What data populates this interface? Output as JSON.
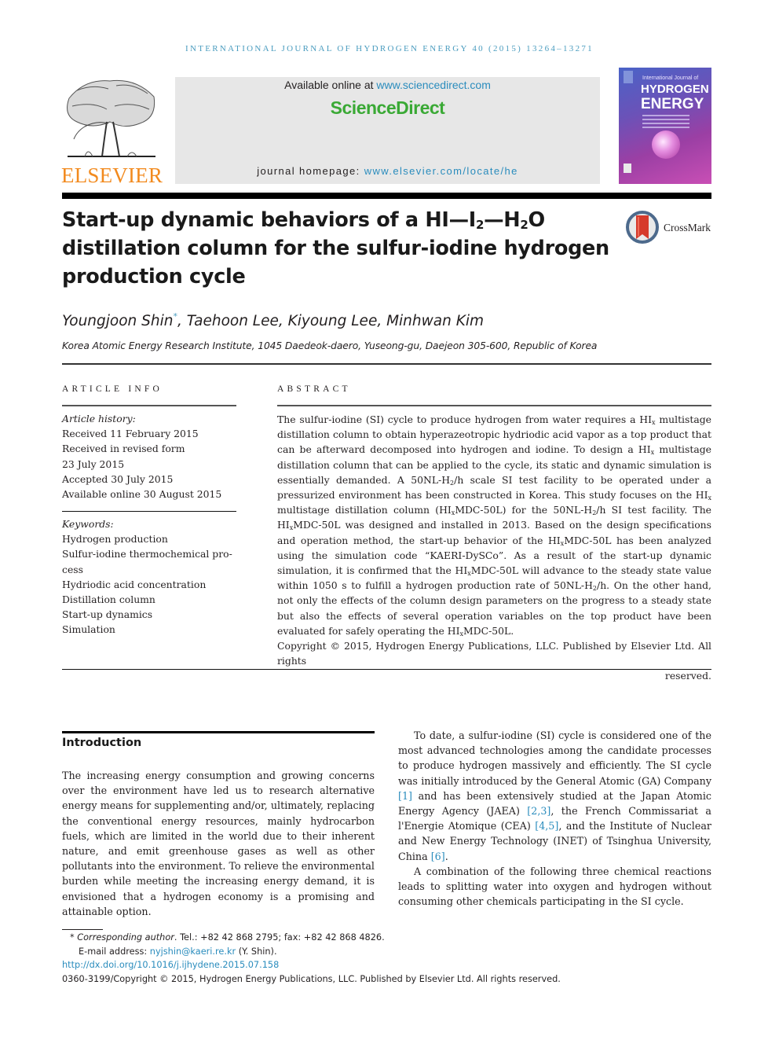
{
  "running_head": "International Journal of Hydrogen Energy 40 (2015) 13264–13271",
  "masthead": {
    "publisher_logo_text": "ELSEVIER",
    "available_online_prefix": "Available online at ",
    "available_online_link": "www.sciencedirect.com",
    "platform_name": "ScienceDirect",
    "homepage_prefix": "journal homepage: ",
    "homepage_link": "www.elsevier.com/locate/he",
    "cover": {
      "line1": "International Journal of",
      "line2": "HYDROGEN",
      "line3": "ENERGY"
    },
    "crossmark_label": "CrossMark"
  },
  "article": {
    "title_part1": "Start-up dynamic behaviors of a HI—I",
    "title_sub1": "2",
    "title_part2": "—H",
    "title_sub2": "2",
    "title_part3": "O distillation column for the sulfur-iodine hydrogen production cycle",
    "authors": {
      "first": "Youngjoon Shin",
      "corresponding_mark": "*",
      "rest": ", Taehoon Lee, Kiyoung Lee, Minhwan Kim"
    },
    "affiliation": "Korea Atomic Energy Research Institute, 1045 Daedeok-daero, Yuseong-gu, Daejeon 305-600, Republic of Korea"
  },
  "article_info": {
    "heading": "ARTICLE INFO",
    "history_label": "Article history:",
    "history": [
      "Received 11 February 2015",
      "Received in revised form",
      "23 July 2015",
      "Accepted 30 July 2015",
      "Available online 30 August 2015"
    ],
    "keywords_label": "Keywords:",
    "keywords": [
      "Hydrogen production",
      "Sulfur-iodine thermochemical pro-",
      "cess",
      "Hydriodic acid concentration",
      "Distillation column",
      "Start-up dynamics",
      "Simulation"
    ]
  },
  "abstract": {
    "heading": "ABSTRACT",
    "segments": [
      {
        "t": "The sulfur-iodine (SI) cycle to produce hydrogen from water requires a HI"
      },
      {
        "sub": "x"
      },
      {
        "t": " multistage distillation column to obtain hyperazeotropic hydriodic acid vapor as a top product that can be afterward decomposed into hydrogen and iodine. To design a HI"
      },
      {
        "sub": "x"
      },
      {
        "t": " multistage distillation column that can be applied to the cycle, its static and dynamic simulation is essentially demanded. A 50NL-H"
      },
      {
        "sub": "2"
      },
      {
        "t": "/h scale SI test facility to be operated under a pressurized environment has been constructed in Korea. This study focuses on the HI"
      },
      {
        "sub": "x"
      },
      {
        "t": " multistage distillation column (HI"
      },
      {
        "sub": "x"
      },
      {
        "t": "MDC-50L) for the 50NL-H"
      },
      {
        "sub": "2"
      },
      {
        "t": "/h SI test facility. The HI"
      },
      {
        "sub": "x"
      },
      {
        "t": "MDC-50L was designed and installed in 2013. Based on the design specifications and operation method, the start-up behavior of the HI"
      },
      {
        "sub": "x"
      },
      {
        "t": "MDC-50L has been analyzed using the simulation code “KAERI-DySCo”. As a result of the start-up dynamic simulation, it is confirmed that the HI"
      },
      {
        "sub": "x"
      },
      {
        "t": "MDC-50L will advance to the steady state value within 1050 s to fulfill a hydrogen production rate of 50NL-H"
      },
      {
        "sub": "2"
      },
      {
        "t": "/h. On the other hand, not only the effects of the column design parameters on the progress to a steady state but also the effects of several operation variables on the top product have been evaluated for safely operating the HI"
      },
      {
        "sub": "x"
      },
      {
        "t": "MDC-50L."
      }
    ],
    "copyright_line": "Copyright © 2015, Hydrogen Energy Publications, LLC. Published by Elsevier Ltd. All rights",
    "copyright_end": "reserved."
  },
  "introduction": {
    "heading": "Introduction",
    "para1": "The increasing energy consumption and growing concerns over the environment have led us to research alternative energy means for supplementing and/or, ultimately, replacing the conventional energy resources, mainly hydrocarbon fuels, which are limited in the world due to their inherent nature, and emit greenhouse gases as well as other pollutants into the environment. To relieve the environmental burden while meeting the increasing energy demand, it is envisioned that a hydrogen economy is a promising and attainable option.",
    "para2_segments": [
      {
        "t": "To date, a sulfur-iodine (SI) cycle is considered one of the most advanced technologies among the candidate processes to produce hydrogen massively and efficiently. The SI cycle was initially introduced by the General Atomic (GA) Company "
      },
      {
        "ref": "[1]"
      },
      {
        "t": " and has been extensively studied at the Japan Atomic Energy Agency (JAEA) "
      },
      {
        "ref": "[2,3]"
      },
      {
        "t": ", the French Commissariat a l'Energie Atomique (CEA) "
      },
      {
        "ref": "[4,5]"
      },
      {
        "t": ", and the Institute of Nuclear and New Energy Technology (INET) of Tsinghua University, China "
      },
      {
        "ref": "[6]"
      },
      {
        "t": "."
      }
    ],
    "para3": "A combination of the following three chemical reactions leads to splitting water into oxygen and hydrogen without consuming other chemicals participating in the SI cycle."
  },
  "footnotes": {
    "mark": "*",
    "corresponding_label": "Corresponding author",
    "contact": ". Tel.: +82 42 868 2795; fax: +82 42 868 4826.",
    "email_label": "E-mail address: ",
    "email": "nyjshin@kaeri.re.kr",
    "email_suffix": " (Y. Shin).",
    "doi": "http://dx.doi.org/10.1016/j.ijhydene.2015.07.158",
    "issn_copyright": "0360-3199/Copyright © 2015, Hydrogen Energy Publications, LLC. Published by Elsevier Ltd. All rights reserved."
  },
  "colors": {
    "link": "#2a8cbd",
    "running_head": "#4a9cbf",
    "sciencedirect_green": "#3aa935",
    "elsevier_orange": "#f28a1e",
    "masthead_gray": "#e7e7e7"
  }
}
